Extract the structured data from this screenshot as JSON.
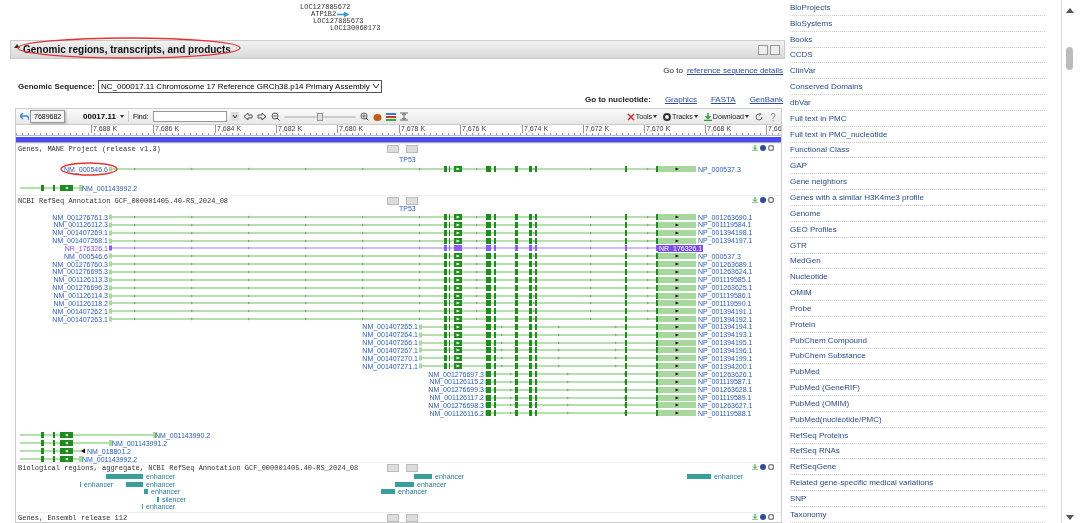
{
  "top_genes": [
    {
      "label": "LOC127885672",
      "kind": "plain"
    },
    {
      "label": "ATP1B2",
      "kind": "arrow"
    },
    {
      "label": "LOC127885673",
      "kind": "plain"
    },
    {
      "label": "LOC130060173",
      "kind": "plain"
    }
  ],
  "section": {
    "title": "Genomic regions, transcripts, and products",
    "highlighted": true
  },
  "reference": {
    "prefix": "Go to",
    "link": "reference sequence details"
  },
  "genomic_sequence": {
    "label": "Genomic Sequence:",
    "value": "NC_000017.11 Chromosome 17 Reference GRCh38.p14 Primary Assembly"
  },
  "nucleotide": {
    "label": "Go to nucleotide:",
    "links": [
      "Graphics",
      "FASTA",
      "GenBank"
    ]
  },
  "viewer": {
    "tooltip": "7689682",
    "sequence": "00017.11",
    "find_label": "Find:",
    "zoom": {
      "level": 0.5
    },
    "menus": [
      "Tools",
      "Tracks",
      "Download"
    ],
    "ruler": [
      "7,688 K",
      "7,686 K",
      "7,684 K",
      "7,682 K",
      "7,680 K",
      "7,678 K",
      "7,676 K",
      "7,674 K",
      "7,672 K",
      "7,670 K",
      "7,668 K",
      "7,66"
    ],
    "tracks": [
      {
        "kind": "genes",
        "title": "Genes, MANE Project (release v1.3)",
        "gene": "TP53",
        "groups": [
          {
            "rows": [
              {
                "left": "NM_000546.6",
                "right": "NP_000537.3",
                "kind": "coding",
                "highlighted": true
              }
            ]
          }
        ],
        "reverse_rows": [
          {
            "label": "NM_001143992.2"
          }
        ]
      },
      {
        "kind": "genes",
        "title": "NCBI RefSeq Annotation GCF_000001405.40-RS_2024_08",
        "gene": "TP53",
        "groups": [
          {
            "rows": [
              {
                "left": "NM_001276761.3",
                "right": "NP_001263690.1",
                "kind": "coding",
                "highlighted": false
              },
              {
                "left": "NM_001126112.3",
                "right": "NP_001119584.1",
                "kind": "coding",
                "highlighted": false
              },
              {
                "left": "NM_001407269.1",
                "right": "NP_001394198.1",
                "kind": "coding",
                "highlighted": false
              },
              {
                "left": "NM_001407268.1",
                "right": "NP_001394197.1",
                "kind": "coding",
                "highlighted": false
              },
              {
                "left": "NR_176326.1",
                "right": "NR_176326.1",
                "kind": "noncoding",
                "highlighted": false
              },
              {
                "left": "NM_000546.6",
                "right": "NP_000537.3",
                "kind": "coding",
                "highlighted": false
              },
              {
                "left": "NM_001276760.3",
                "right": "NP_001263689.1",
                "kind": "coding",
                "highlighted": false
              },
              {
                "left": "NM_001276695.3",
                "right": "NP_001263624.1",
                "kind": "coding",
                "highlighted": false
              },
              {
                "left": "NM_001126113.3",
                "right": "NP_001119585.1",
                "kind": "coding",
                "highlighted": false
              },
              {
                "left": "NM_001276696.3",
                "right": "NP_001263625.1",
                "kind": "coding",
                "highlighted": false
              },
              {
                "left": "NM_001126114.3",
                "right": "NP_001119586.1",
                "kind": "coding",
                "highlighted": false
              },
              {
                "left": "NM_001126118.2",
                "right": "NP_001119590.1",
                "kind": "coding",
                "highlighted": false
              },
              {
                "left": "NM_001407262.1",
                "right": "NP_001394191.1",
                "kind": "coding",
                "highlighted": false
              },
              {
                "left": "NM_001407263.1",
                "right": "NP_001394192.1",
                "kind": "coding",
                "highlighted": false
              }
            ]
          },
          {
            "rows": [
              {
                "left": "NM_001407265.1",
                "right": "NP_001394194.1",
                "kind": "coding",
                "highlighted": false
              },
              {
                "left": "NM_001407264.1",
                "right": "NP_001394193.1",
                "kind": "coding",
                "highlighted": false
              },
              {
                "left": "NM_001407266.1",
                "right": "NP_001394195.1",
                "kind": "coding",
                "highlighted": false
              },
              {
                "left": "NM_001407267.1",
                "right": "NP_001394196.1",
                "kind": "coding",
                "highlighted": false
              },
              {
                "left": "NM_001407270.1",
                "right": "NP_001394199.1",
                "kind": "coding",
                "highlighted": false
              },
              {
                "left": "NM_001407271.1",
                "right": "NP_001394200.1",
                "kind": "coding",
                "highlighted": false
              }
            ]
          },
          {
            "rows": [
              {
                "left": "NM_001276697.3",
                "right": "NP_001263626.1",
                "kind": "coding",
                "highlighted": false
              },
              {
                "left": "NM_001126115.2",
                "right": "NP_001119587.1",
                "kind": "coding",
                "highlighted": false
              },
              {
                "left": "NM_001276699.3",
                "right": "NP_001263628.1",
                "kind": "coding",
                "highlighted": false
              },
              {
                "left": "NM_001126117.2",
                "right": "NP_001119589.1",
                "kind": "coding",
                "highlighted": false
              },
              {
                "left": "NM_001276698.3",
                "right": "NP_001263627.1",
                "kind": "coding",
                "highlighted": false
              },
              {
                "left": "NM_001126116.2",
                "right": "NP_001119588.1",
                "kind": "coding",
                "highlighted": false
              }
            ]
          }
        ],
        "reverse_rows": [
          {
            "label": "NM_001143990.2"
          },
          {
            "label": "NM_001143991.2"
          },
          {
            "label": "NM_018801.2"
          },
          {
            "label": "NM_001143992.2"
          }
        ]
      },
      {
        "kind": "regions",
        "title": "Biological regions, aggregate, NCBI RefSeq Annotation GCF_000001405.40-RS_2024_08",
        "features": [
          {
            "label": "enhancer",
            "kind": "enhancer"
          },
          {
            "label": "enhancer",
            "kind": "enhancer"
          },
          {
            "label": "enhancer",
            "kind": "enhancer"
          },
          {
            "label": "enhancer",
            "kind": "enhancer"
          },
          {
            "label": "silencer",
            "kind": "silencer"
          },
          {
            "label": "enhancer",
            "kind": "enhancer"
          },
          {
            "label": "enhancer",
            "kind": "enhancer"
          },
          {
            "label": "enhancer",
            "kind": "enhancer"
          },
          {
            "label": "enhancer",
            "kind": "enhancer"
          },
          {
            "label": "enhancer",
            "kind": "enhancer"
          }
        ]
      },
      {
        "kind": "genes",
        "title": "Genes, Ensembl release 112"
      }
    ]
  },
  "sidebar": {
    "links": [
      "BioProjects",
      "BioSystems",
      "Books",
      "CCDS",
      "ClinVar",
      "Conserved Domains",
      "dbVar",
      "Full text in PMC",
      "Full text in PMC_nucleotide",
      "Functional Class",
      "GAP",
      "Gene neighbors",
      "Genes with a similar H3K4me3 profile",
      "Genome",
      "GEO Profiles",
      "GTR",
      "MedGen",
      "Nucleotide",
      "OMIM",
      "Probe",
      "Protein",
      "PubChem Compound",
      "PubChem Substance",
      "PubMed",
      "PubMed (GeneRIF)",
      "PubMed (OMIM)",
      "PubMed(nucleotide/PMC)",
      "RefSeq Proteins",
      "RefSeq RNAs",
      "RefSeqGene",
      "Related gene-specific medical variations",
      "SNP",
      "Taxonomy"
    ]
  }
}
